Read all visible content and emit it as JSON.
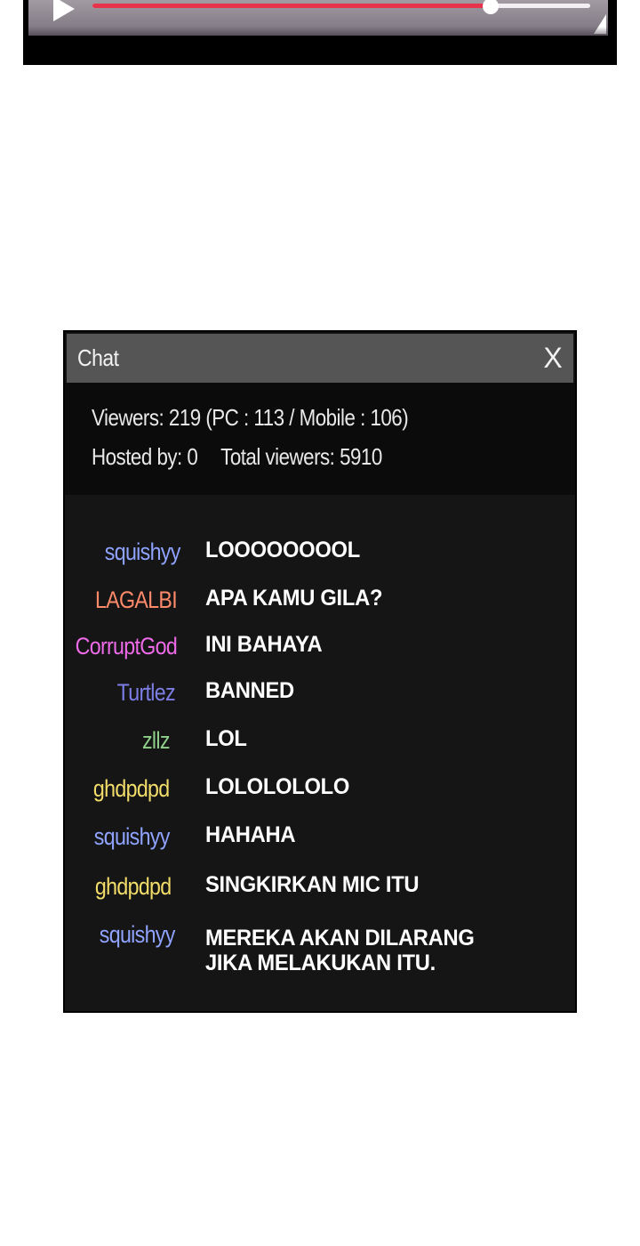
{
  "player": {
    "icon": "play-icon",
    "progress": 0.8,
    "accent_color": "#e8344a"
  },
  "chat": {
    "title": "Chat",
    "close_label": "X",
    "stats": {
      "viewers": "Viewers: 219 (PC : 113 / Mobile : 106)",
      "hosted_by": "Hosted by: 0",
      "total_viewers": "Total viewers: 5910"
    },
    "messages": [
      {
        "user": "squishyy",
        "text": "LOOOOOOOOL",
        "color": "#8fa3ff"
      },
      {
        "user": "LAGALBI",
        "text": "APA KAMU GILA?",
        "color": "#ff8a6a"
      },
      {
        "user": "CorruptGod",
        "text": "INI BAHAYA",
        "color": "#ee6ae8"
      },
      {
        "user": "Turtlez",
        "text": "BANNED",
        "color": "#7c7ee6"
      },
      {
        "user": "zllz",
        "text": "LOL",
        "color": "#8fd08a"
      },
      {
        "user": "ghdpdpd",
        "text": "LOLOLOLOLO",
        "color": "#f2dd6a"
      },
      {
        "user": "squishyy",
        "text": "HAHAHA",
        "color": "#8fa3ff"
      },
      {
        "user": "ghdpdpd",
        "text": "SINGKIRKAN MIC ITU",
        "color": "#f2dd6a"
      },
      {
        "user": "squishyy",
        "text": "MEREKA AKAN DILARANG\nJIKA MELAKUKAN ITU.",
        "color": "#8fa3ff"
      }
    ]
  }
}
